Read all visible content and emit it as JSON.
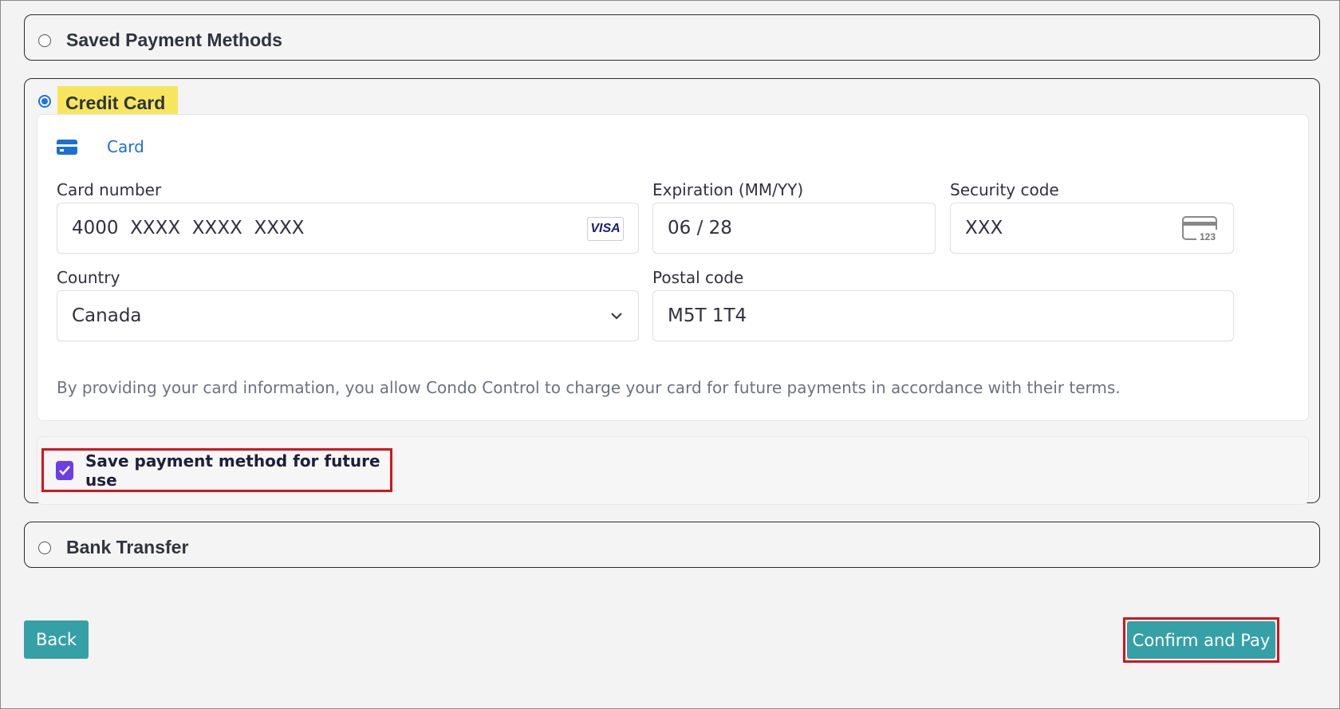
{
  "options": {
    "saved": {
      "label": "Saved Payment Methods",
      "selected": false
    },
    "credit": {
      "label": "Credit Card",
      "selected": true
    },
    "bank": {
      "label": "Bank Transfer",
      "selected": false
    }
  },
  "card_tab": {
    "label": "Card",
    "icon": "credit-card-icon"
  },
  "fields": {
    "card_number": {
      "label": "Card number",
      "value": "4000  XXXX  XXXX  XXXX",
      "brand": "VISA"
    },
    "expiration": {
      "label": "Expiration (MM/YY)",
      "value": "06 / 28"
    },
    "security": {
      "label": "Security code",
      "value": "XXX",
      "icon_text": "123"
    },
    "country": {
      "label": "Country",
      "value": "Canada"
    },
    "postal": {
      "label": "Postal code",
      "value": "M5T 1T4"
    }
  },
  "terms": "By providing your card information, you allow Condo Control to charge your card for future payments in accordance with their terms.",
  "save_method": {
    "label": "Save payment method for future use",
    "checked": true
  },
  "buttons": {
    "back": "Back",
    "confirm": "Confirm and Pay"
  },
  "colors": {
    "accent": "#35a0a6",
    "highlight_border": "#d4141c",
    "link_blue": "#1a6fd6",
    "checkbox": "#6c3ce9"
  }
}
